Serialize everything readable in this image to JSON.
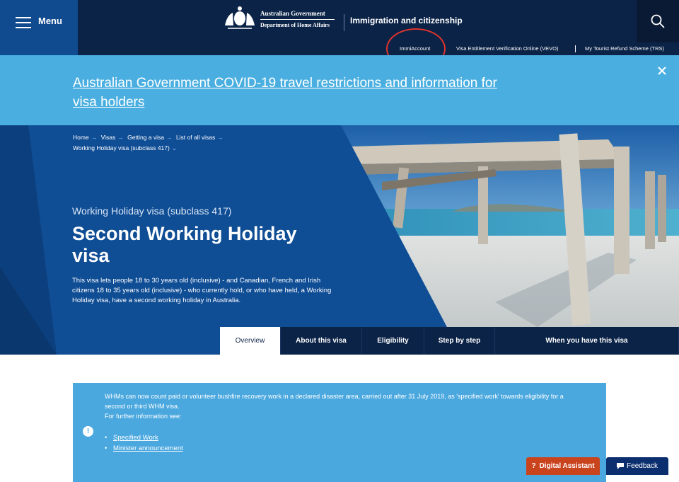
{
  "header": {
    "menu_label": "Menu",
    "govt_line1": "Australian Government",
    "govt_line2": "Department of Home Affairs",
    "site_title": "Immigration and citizenship",
    "search_icon": "search-icon"
  },
  "subnav": {
    "items": [
      "ImmiAccount",
      "Visa Entitlement Verification Online (VEVO)",
      "My Tourist Refund Scheme (TRS)"
    ]
  },
  "covid_banner": {
    "link_text": "Australian Government COVID-19 travel restrictions and information for visa holders",
    "close_icon": "close-icon"
  },
  "breadcrumb": {
    "items": [
      "Home",
      "Visas",
      "Getting a visa",
      "List of all visas",
      "Working Holiday visa (subclass 417)"
    ]
  },
  "hero": {
    "subtitle": "Working Holiday visa (subclass 417)",
    "title": "Second Working Holiday visa",
    "description": "This visa lets people 18 to 30 years old (inclusive) - and Canadian, French and Irish citizens 18 to 35 years old (inclusive) - who currently hold, or who have held, a Working Holiday visa, have a second working holiday in Australia."
  },
  "tabs": [
    "Overview",
    "About this visa",
    "Eligibility",
    "Step by step",
    "When you have this visa"
  ],
  "info_box": {
    "text": "WHMs can now count paid or volunteer bushfire recovery work in a declared disaster area, carried out after 31 July 2019, as 'specified work' towards eligibility for a second or third WHM visa.",
    "further": "For further information see:",
    "links": [
      "Specified Work",
      "Minister announcement"
    ]
  },
  "floating": {
    "assistant_icon": "?",
    "assistant_label": "Digital Assistant",
    "feedback_label": "Feedback"
  },
  "colors": {
    "navy": "#0b2347",
    "blue": "#104a8f",
    "light_blue": "#4aafe0",
    "annotation_red": "#e0342d"
  }
}
